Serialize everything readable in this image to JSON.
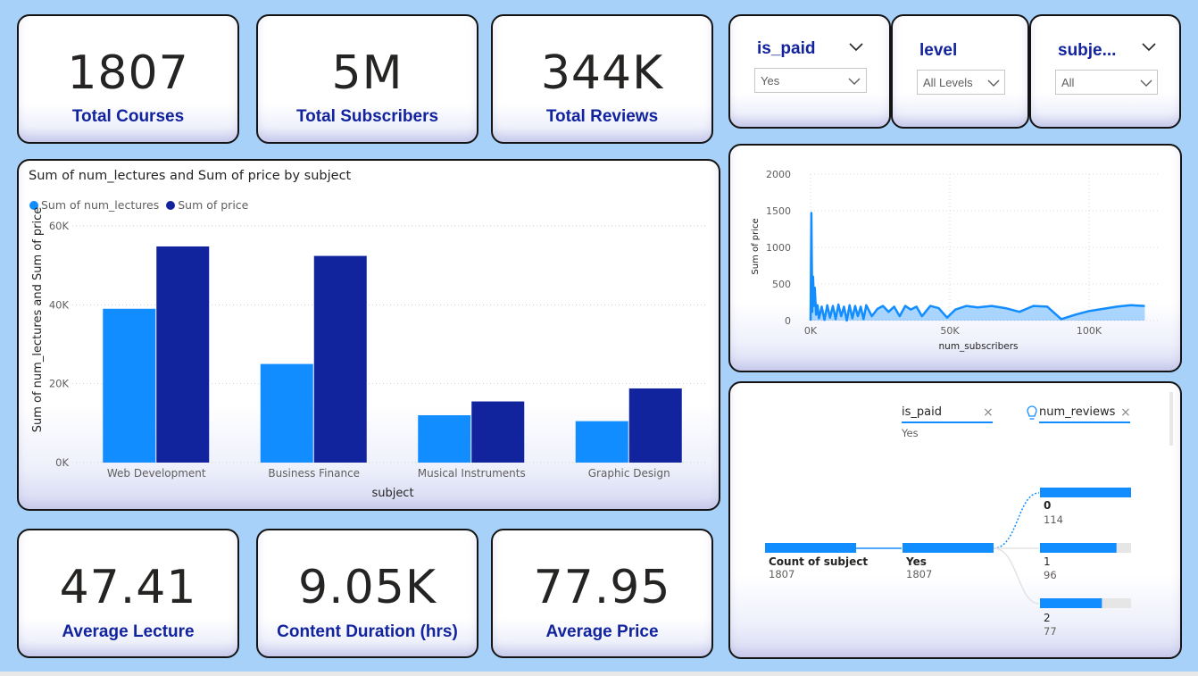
{
  "kpis": {
    "total_courses": {
      "value": "1807",
      "label": "Total Courses"
    },
    "total_subscribers": {
      "value": "5M",
      "label": "Total Subscribers"
    },
    "total_reviews": {
      "value": "344K",
      "label": "Total Reviews"
    },
    "average_lecture": {
      "value": "47.41",
      "label": "Average Lecture"
    },
    "content_duration": {
      "value": "9.05K",
      "label": "Content Duration (hrs)"
    },
    "average_price": {
      "value": "77.95",
      "label": "Average Price"
    }
  },
  "slicers": {
    "is_paid": {
      "title": "is_paid",
      "value": "Yes",
      "icon": "chevron-down-icon"
    },
    "level": {
      "title": "level",
      "value": "All Levels",
      "icon": "chevron-down-icon"
    },
    "subject": {
      "title": "subje...",
      "value": "All",
      "icon": "chevron-down-icon"
    }
  },
  "colors": {
    "series_light": "#118dff",
    "series_dark": "#12239e",
    "label_blue": "#12239e",
    "background": "#a8d1f9"
  },
  "chart_data": [
    {
      "type": "bar",
      "title": "Sum of num_lectures and Sum of price by subject",
      "xlabel": "subject",
      "ylabel": "Sum of num_lectures and Sum of price",
      "categories": [
        "Web Development",
        "Business Finance",
        "Musical Instruments",
        "Graphic Design"
      ],
      "series": [
        {
          "name": "Sum of num_lectures",
          "values": [
            39000,
            25000,
            12000,
            10500
          ]
        },
        {
          "name": "Sum of price",
          "values": [
            54800,
            52400,
            15500,
            18800
          ]
        }
      ],
      "ylim": [
        0,
        60000
      ],
      "yticks": [
        "0K",
        "20K",
        "40K",
        "60K"
      ],
      "grid": true,
      "legend": "top-left"
    },
    {
      "type": "area",
      "xlabel": "num_subscribers",
      "ylabel": "Sum of price",
      "xlim": [
        0,
        125000
      ],
      "ylim": [
        0,
        2000
      ],
      "xticks": [
        "0K",
        "50K",
        "100K"
      ],
      "yticks": [
        "0",
        "500",
        "1000",
        "1500",
        "2000"
      ],
      "grid": true,
      "x": [
        0,
        300,
        600,
        900,
        1200,
        1500,
        2000,
        2500,
        3000,
        4000,
        5000,
        6000,
        7000,
        8000,
        9000,
        10000,
        11000,
        12000,
        13000,
        14000,
        15000,
        16000,
        17000,
        18000,
        19000,
        20000,
        22000,
        24000,
        26000,
        28000,
        30000,
        32000,
        34000,
        36000,
        38000,
        40000,
        43000,
        46000,
        49000,
        52000,
        56000,
        60000,
        65000,
        70000,
        75000,
        80000,
        85000,
        90000,
        95000,
        100000,
        105000,
        110000,
        115000,
        120000
      ],
      "y": [
        0,
        1470,
        120,
        600,
        200,
        450,
        80,
        210,
        30,
        190,
        10,
        210,
        40,
        200,
        20,
        220,
        60,
        190,
        0,
        210,
        30,
        200,
        60,
        190,
        20,
        210,
        60,
        160,
        200,
        120,
        190,
        60,
        200,
        150,
        190,
        60,
        200,
        170,
        40,
        150,
        200,
        180,
        200,
        170,
        120,
        200,
        190,
        20,
        80,
        130,
        160,
        190,
        210,
        200
      ]
    },
    {
      "type": "decomposition-tree",
      "root": {
        "label": "Count of subject",
        "value": "1807"
      },
      "levels": [
        {
          "field": "is_paid",
          "selected": "Yes"
        },
        {
          "field": "num_reviews",
          "selected": ""
        }
      ],
      "level1": [
        {
          "label": "Yes",
          "value": "1807"
        }
      ],
      "level2": [
        {
          "label": "0",
          "value": "114",
          "fraction": 1.0
        },
        {
          "label": "1",
          "value": "96",
          "fraction": 0.84
        },
        {
          "label": "2",
          "value": "77",
          "fraction": 0.68
        }
      ]
    }
  ]
}
